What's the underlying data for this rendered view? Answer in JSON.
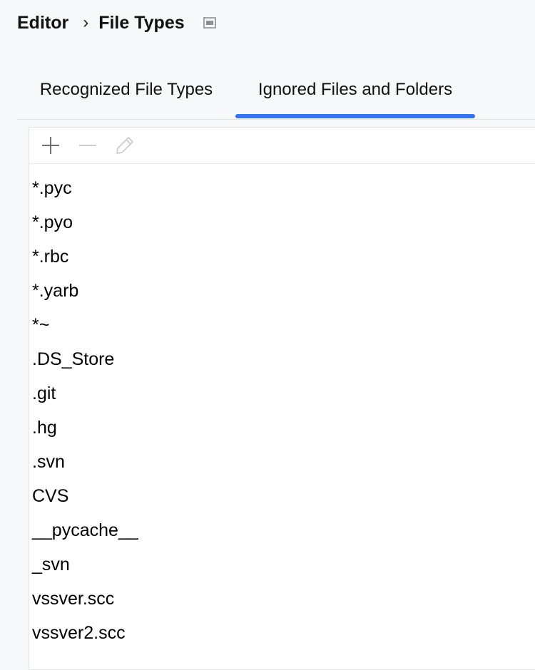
{
  "breadcrumb": {
    "parent": "Editor",
    "separator": "›",
    "current": "File Types",
    "layout_icon": "layout-panel-icon"
  },
  "tabs": [
    {
      "label": "Recognized File Types",
      "selected": false
    },
    {
      "label": "Ignored Files and Folders",
      "selected": true
    }
  ],
  "toolbar": {
    "add_icon": "plus-icon",
    "remove_icon": "minus-icon",
    "edit_icon": "pencil-icon"
  },
  "ignored_patterns": [
    "*.pyc",
    "*.pyo",
    "*.rbc",
    "*.yarb",
    "*~",
    ".DS_Store",
    ".git",
    ".hg",
    ".svn",
    "CVS",
    "__pycache__",
    "_svn",
    "vssver.scc",
    "vssver2.scc"
  ],
  "colors": {
    "accent": "#3574f0",
    "icon_gray": "#6c707e",
    "icon_disabled": "#c9ccd6"
  }
}
